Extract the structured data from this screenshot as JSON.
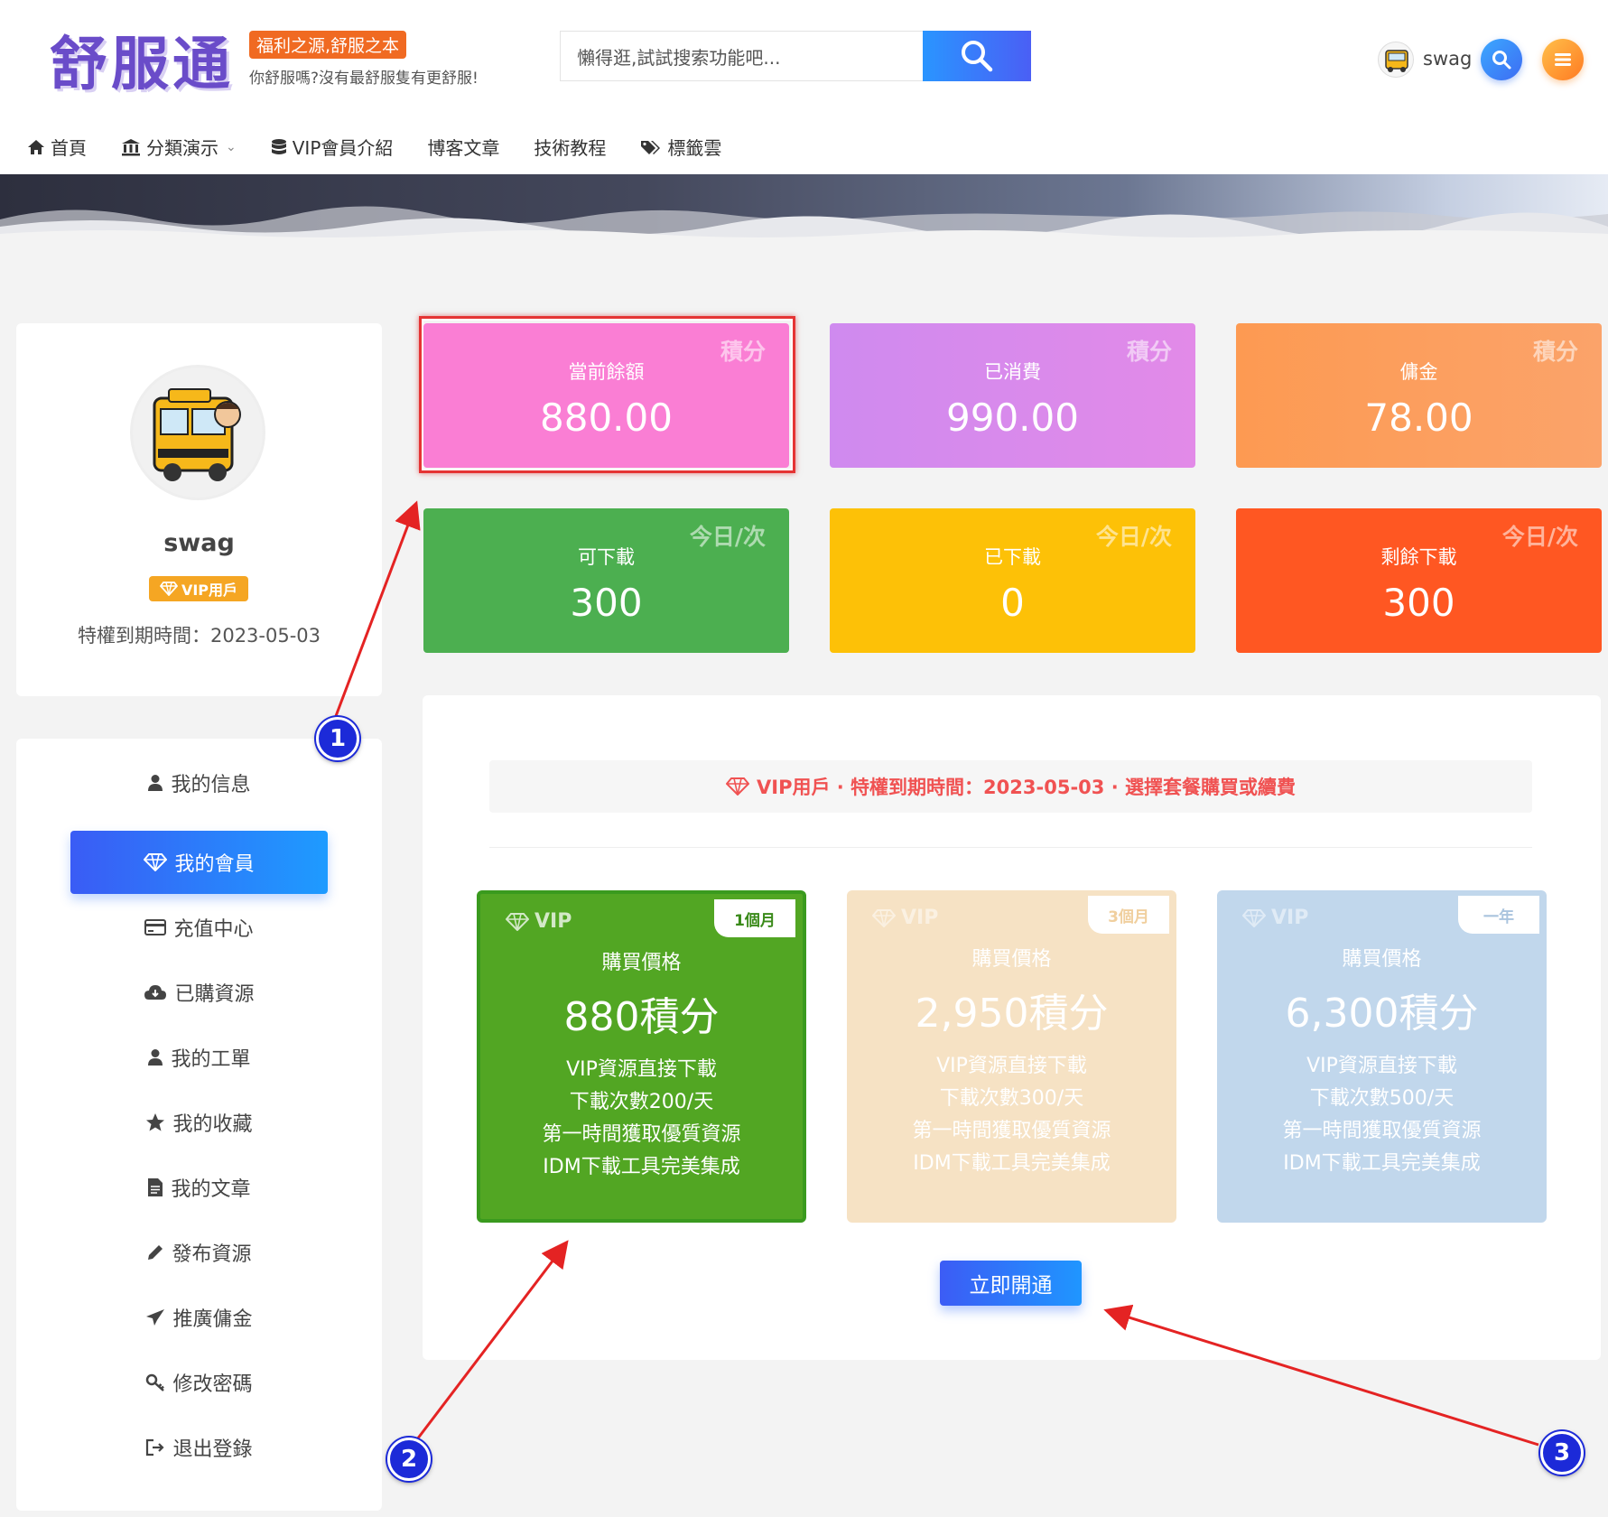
{
  "header": {
    "logo": "舒服通",
    "slogan_badge": "福利之源,舒服之本",
    "slogan_sub": "你舒服嗎?沒有最舒服隻有更舒服!",
    "search_placeholder": "懶得逛,試試搜索功能吧...",
    "user_name": "swag"
  },
  "nav": {
    "items": [
      "首頁",
      "分類演示",
      "VIP會員介紹",
      "博客文章",
      "技術教程",
      "標籤雲"
    ]
  },
  "profile": {
    "name": "swag",
    "badge": "VIP用戶",
    "expiry": "特權到期時間：2023-05-03"
  },
  "menu": {
    "items": [
      "我的信息",
      "我的會員",
      "充值中心",
      "已購資源",
      "我的工單",
      "我的收藏",
      "我的文章",
      "發布資源",
      "推廣傭金",
      "修改密碼",
      "退出登錄"
    ],
    "active_index": 1
  },
  "stats": [
    {
      "tag": "積分",
      "label": "當前餘額",
      "value": "880.00",
      "color": "#fa7ed4"
    },
    {
      "tag": "積分",
      "label": "已消費",
      "value": "990.00",
      "color": "#d68aee"
    },
    {
      "tag": "積分",
      "label": "傭金",
      "value": "78.00",
      "color": "#fb9b56"
    },
    {
      "tag": "今日/次",
      "label": "可下載",
      "value": "300",
      "color": "#4caf50"
    },
    {
      "tag": "今日/次",
      "label": "已下載",
      "value": "0",
      "color": "#fdc107"
    },
    {
      "tag": "今日/次",
      "label": "剩餘下載",
      "value": "300",
      "color": "#ff5722"
    }
  ],
  "vip": {
    "notice": "VIP用戶 · 特權到期時間：2023-05-03 · 選擇套餐購買或續費",
    "plans": [
      {
        "vip": "VIP",
        "period": "1個月",
        "price_label": "購買價格",
        "price": "880積分",
        "features": [
          "VIP資源直接下載",
          "下載次數200/天",
          "第一時間獲取優質資源",
          "IDM下載工具完美集成"
        ],
        "color": "#52a623",
        "selected": true
      },
      {
        "vip": "VIP",
        "period": "3個月",
        "price_label": "購買價格",
        "price": "2,950積分",
        "features": [
          "VIP資源直接下載",
          "下載次數300/天",
          "第一時間獲取優質資源",
          "IDM下載工具完美集成"
        ],
        "color": "#f6e2c4",
        "selected": false
      },
      {
        "vip": "VIP",
        "period": "一年",
        "price_label": "購買價格",
        "price": "6,300積分",
        "features": [
          "VIP資源直接下載",
          "下載次數500/天",
          "第一時間獲取優質資源",
          "IDM下載工具完美集成"
        ],
        "color": "#c1d7ec",
        "selected": false
      }
    ],
    "button": "立即開通"
  },
  "annotations": [
    "1",
    "2",
    "3"
  ]
}
